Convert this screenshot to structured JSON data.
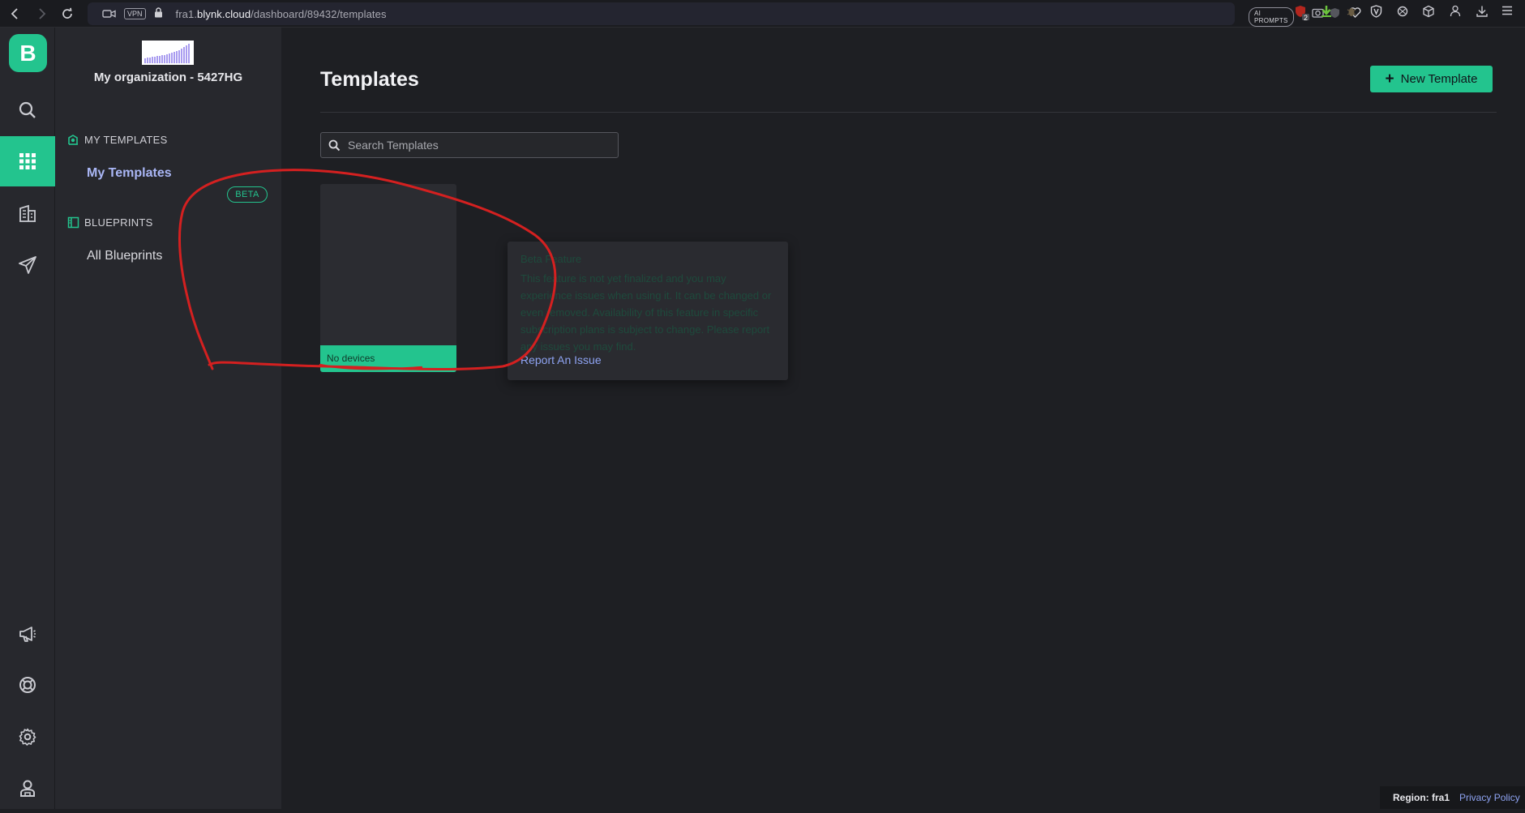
{
  "browser": {
    "url_prefix": "fra1.",
    "url_domain": "blynk.cloud",
    "url_path": "/dashboard/89432/templates",
    "vpn_label": "VPN",
    "ai_prompts_label": "AI PROMPTS",
    "badge_count": "2"
  },
  "rail": {
    "logo_letter": "B",
    "items": [
      "search-icon",
      "templates-grid-icon",
      "organizations-icon",
      "send-icon"
    ],
    "bottom_items": [
      "announcements-icon",
      "help-icon",
      "settings-icon",
      "user-icon"
    ],
    "accent": "#23c48e"
  },
  "sidebar": {
    "org_name": "My organization - 5427HG",
    "my_templates_heading": "MY TEMPLATES",
    "my_templates_link": "My Templates",
    "blueprints_heading": "BLUEPRINTS",
    "beta_badge": "BETA",
    "all_blueprints_link": "All Blueprints"
  },
  "main": {
    "title": "Templates",
    "new_button_label": "New Template",
    "search_placeholder": "Search Templates",
    "template_card": {
      "devices_label": "No devices"
    }
  },
  "tooltip": {
    "title": "Beta Feature",
    "body": "This feature is not yet finalized and you may experience issues when using it. It can be changed or even removed. Availability of this feature in specific subscription plans is subject to change. Please report any issues you may find.",
    "link": "Report An Issue"
  },
  "footer": {
    "region_label": "Region: fra1",
    "privacy_link": "Privacy Policy"
  },
  "colors": {
    "accent": "#23c48e",
    "link": "#8ea3f2",
    "annotation": "#d42020"
  }
}
